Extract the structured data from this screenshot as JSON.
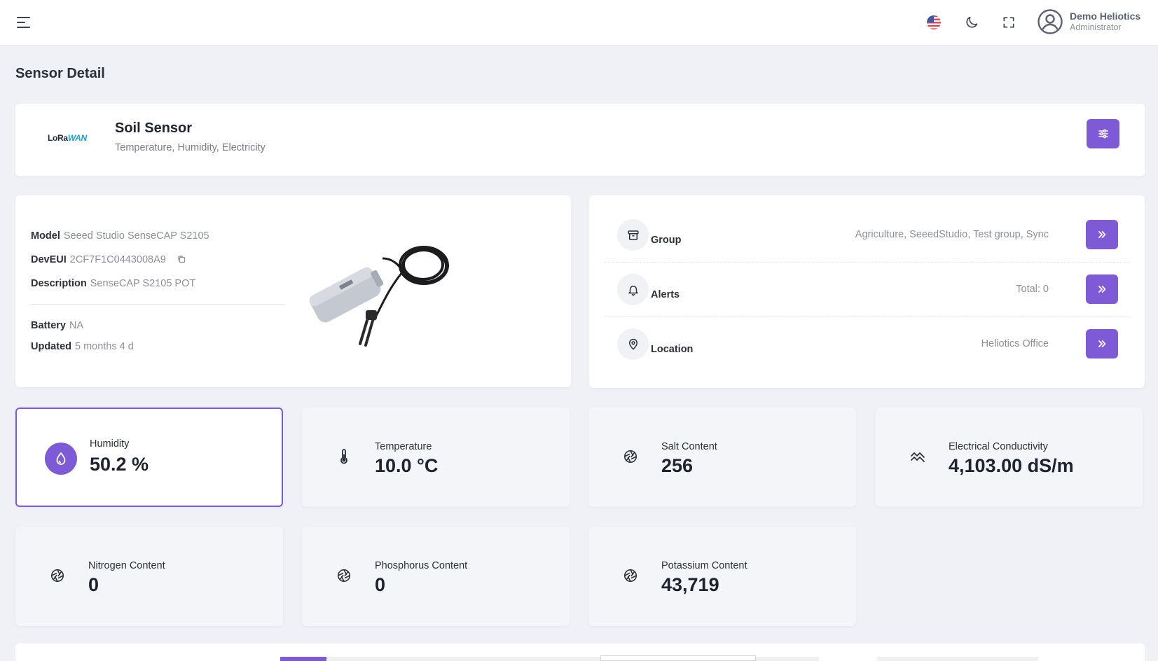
{
  "topbar": {
    "user_name": "Demo Heliotics",
    "user_role": "Administrator",
    "icons": [
      "menu-icon",
      "us-flag-icon",
      "moon-icon",
      "fullscreen-icon",
      "user-circle-icon"
    ]
  },
  "page": {
    "title": "Sensor Detail"
  },
  "sensor": {
    "logo_text_lora": "LoRa",
    "logo_text_wan": "WAN",
    "name": "Soil Sensor",
    "types": "Temperature, Humidity, Electricity"
  },
  "info": {
    "model_label": "Model",
    "model_value": "Seeed Studio SenseCAP S2105",
    "deveui_label": "DevEUI",
    "deveui_value": "2CF7F1C0443008A9",
    "description_label": "Description",
    "description_value": "SenseCAP S2105 POT",
    "battery_label": "Battery",
    "battery_value": "NA",
    "updated_label": "Updated",
    "updated_value": "5 months 4 d"
  },
  "meta": {
    "group_label": "Group",
    "group_value": "Agriculture, SeeedStudio, Test group, Sync",
    "alerts_label": "Alerts",
    "alerts_value": "Total: 0",
    "location_label": "Location",
    "location_value": "Heliotics Office"
  },
  "metrics": [
    {
      "label": "Humidity",
      "value": "50.2 %",
      "icon": "droplet-icon"
    },
    {
      "label": "Temperature",
      "value": "10.0 °C",
      "icon": "thermometer-icon"
    },
    {
      "label": "Salt Content",
      "value": "256",
      "icon": "aperture-icon"
    },
    {
      "label": "Electrical Conductivity",
      "value": "4,103.00 dS/m",
      "icon": "wave-icon"
    },
    {
      "label": "Nitrogen Content",
      "value": "0",
      "icon": "aperture-icon"
    },
    {
      "label": "Phosphorus Content",
      "value": "0",
      "icon": "aperture-icon"
    },
    {
      "label": "Potassium Content",
      "value": "43,719",
      "icon": "aperture-icon"
    }
  ],
  "colors": {
    "accent": "#7e5ad6",
    "background": "#eff1f6"
  }
}
